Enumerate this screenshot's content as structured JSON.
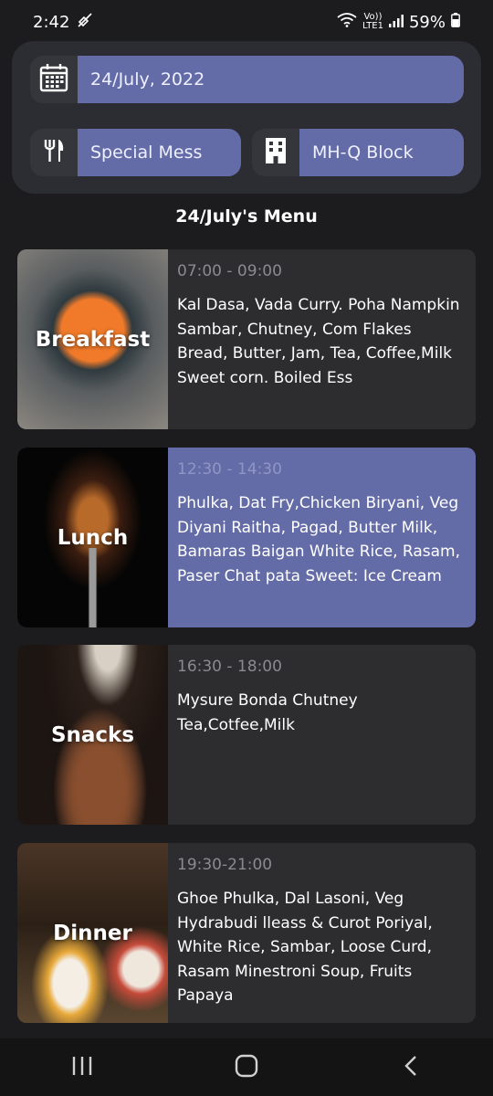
{
  "status_bar": {
    "time": "2:42",
    "network_label_top": "Vo))",
    "network_label_bottom": "LTE1",
    "battery": "59%"
  },
  "filters": {
    "date": "24/July, 2022",
    "mess": "Special Mess",
    "block": "MH-Q Block"
  },
  "menu_title": "24/July's Menu",
  "meals": [
    {
      "label": "Breakfast",
      "time": "07:00 - 09:00",
      "items": "Kal Dasa, Vada Curry. Poha Nampkin Sambar, Chutney, Com Flakes Bread, Butter, Jam, Tea, Coffee,Milk Sweet corn. Boiled Ess"
    },
    {
      "label": "Lunch",
      "time": "12:30 - 14:30",
      "items": "Phulka, Dat Fry,Chicken Biryani, Veg Diyani Raitha, Pagad, Butter Milk, Bamaras Baigan White Rice, Rasam, Paser Chat pata Sweet: Ice Cream"
    },
    {
      "label": "Snacks",
      "time": "16:30 - 18:00",
      "items": "Mysure Bonda Chutney Tea,Cotfee,Milk"
    },
    {
      "label": "Dinner",
      "time": "19:30-21:00",
      "items": "Ghoe Phulka, Dal Lasoni, Veg Hydrabudi lleass & Curot Poriyal, White Rice, Sambar, Loose Curd, Rasam Minestroni Soup, Fruits Papaya"
    }
  ],
  "colors": {
    "accent": "#646ca7",
    "card": "#2d2d2f",
    "background": "#1c1c1e"
  }
}
